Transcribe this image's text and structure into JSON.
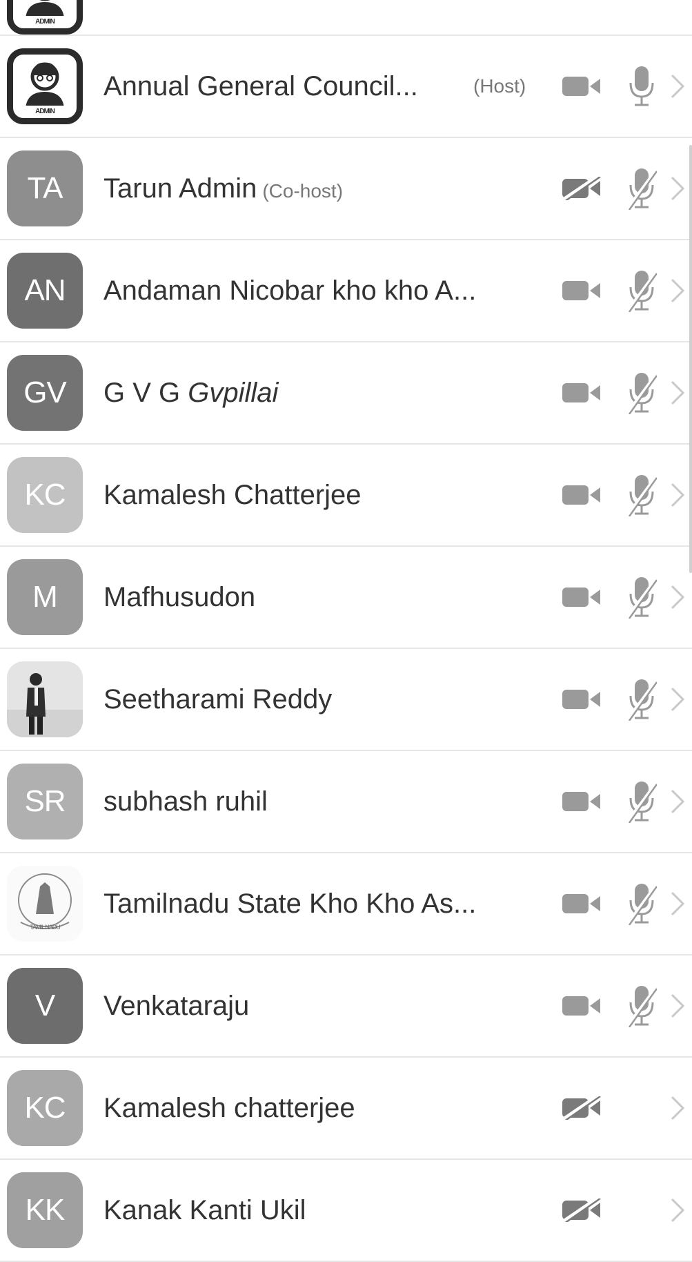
{
  "participants": [
    {
      "initials": "",
      "name": "",
      "role": "",
      "avatar_type": "admin",
      "avatar_text": "ADMIN",
      "partial": true,
      "video": "none",
      "mic": "none"
    },
    {
      "initials": "",
      "name": "Annual General Council...",
      "role": "(Host)",
      "avatar_type": "admin",
      "avatar_text": "ADMIN",
      "video": "on",
      "mic": "on"
    },
    {
      "initials": "TA",
      "name": "Tarun Admin",
      "role": "(Co-host)",
      "avatar_color": "#8e8e8e",
      "video": "off",
      "mic": "muted"
    },
    {
      "initials": "AN",
      "name": "Andaman Nicobar kho kho A...",
      "role": "",
      "avatar_color": "#6f6f6f",
      "video": "on",
      "mic": "muted"
    },
    {
      "initials": "GV",
      "name_plain": "G V G ",
      "name_italic": "Gvpillai",
      "role": "",
      "avatar_color": "#737373",
      "video": "on",
      "mic": "muted"
    },
    {
      "initials": "KC",
      "name": "Kamalesh Chatterjee",
      "role": "",
      "avatar_color": "#c2c2c2",
      "video": "on",
      "mic": "muted"
    },
    {
      "initials": "M",
      "name": "Mafhusudon",
      "role": "",
      "avatar_color": "#9a9a9a",
      "video": "on",
      "mic": "muted"
    },
    {
      "initials": "",
      "name": "Seetharami Reddy",
      "role": "",
      "avatar_type": "photo",
      "video": "on",
      "mic": "muted"
    },
    {
      "initials": "SR",
      "name": "subhash ruhil",
      "role": "",
      "avatar_color": "#b0b0b0",
      "video": "on",
      "mic": "muted"
    },
    {
      "initials": "",
      "name": "Tamilnadu State Kho Kho As...",
      "role": "",
      "avatar_type": "logo",
      "avatar_text": "TAMIL NADU",
      "video": "on",
      "mic": "muted"
    },
    {
      "initials": "V",
      "name": "Venkataraju",
      "role": "",
      "avatar_color": "#6d6d6d",
      "video": "on",
      "mic": "muted"
    },
    {
      "initials": "KC",
      "name": "Kamalesh chatterjee",
      "role": "",
      "avatar_color": "#a9a9a9",
      "video": "off",
      "mic": "none"
    },
    {
      "initials": "KK",
      "name": "Kanak Kanti Ukil",
      "role": "",
      "avatar_color": "#a0a0a0",
      "video": "off",
      "mic": "none"
    }
  ],
  "icons": {
    "video_on": "video-camera-icon",
    "video_off": "video-camera-off-icon",
    "mic_on": "microphone-icon",
    "mic_muted": "microphone-muted-icon",
    "chevron": "chevron-right-icon"
  },
  "colors": {
    "icon": "#9a9a9a",
    "icon_dark": "#7a7a7a",
    "text": "#333333",
    "role": "#777777",
    "divider": "#e6e6e6"
  }
}
